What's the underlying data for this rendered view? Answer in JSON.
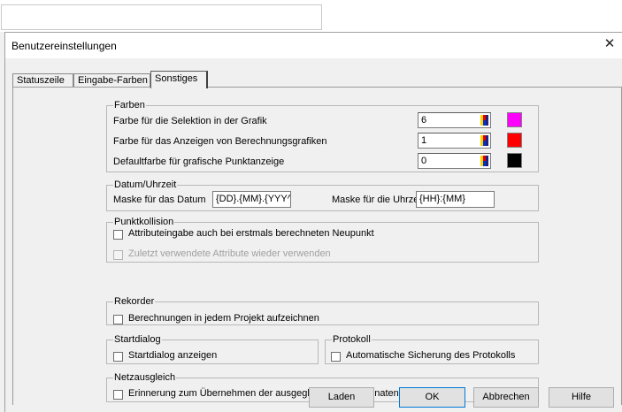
{
  "window": {
    "title": "Benutzereinstellungen",
    "close_glyph": "✕"
  },
  "tabs": [
    "Statuszeile",
    "Eingabe-Farben",
    "Sonstiges"
  ],
  "farben": {
    "legend": "Farben",
    "rows": [
      {
        "label": "Farbe für die Selektion in der Grafik",
        "value": "6",
        "color": "#ff00ff"
      },
      {
        "label": "Farbe für das Anzeigen von Berechnungsgrafiken",
        "value": "1",
        "color": "#ff0000"
      },
      {
        "label": "Defaultfarbe für grafische Punktanzeige",
        "value": "0",
        "color": "#000000"
      }
    ]
  },
  "datum": {
    "legend": "Datum/Uhrzeit",
    "date_label": "Maske für das Datum",
    "date_value": "{DD}.{MM}.{YYY^",
    "time_label": "Maske für die Uhrzeit",
    "time_value": "{HH}:{MM}"
  },
  "punktkollision": {
    "legend": "Punktkollision",
    "option1": "Attributeingabe auch bei erstmals berechneten Neupunkt",
    "option2": "Zuletzt verwendete Attribute wieder verwenden"
  },
  "rekorder": {
    "legend": "Rekorder",
    "option": "Berechnungen in jedem Projekt aufzeichnen"
  },
  "startdialog": {
    "legend": "Startdialog",
    "option": "Startdialog anzeigen"
  },
  "protokoll": {
    "legend": "Protokoll",
    "option": "Automatische Sicherung des Protokolls"
  },
  "netzausgleich": {
    "legend": "Netzausgleich",
    "option": "Erinnerung zum Übernehmen der ausgeglichenen Koordinaten anzeigen"
  },
  "buttons": {
    "load": "Laden",
    "ok": "OK",
    "cancel": "Abbrechen",
    "help": "Hilfe"
  }
}
